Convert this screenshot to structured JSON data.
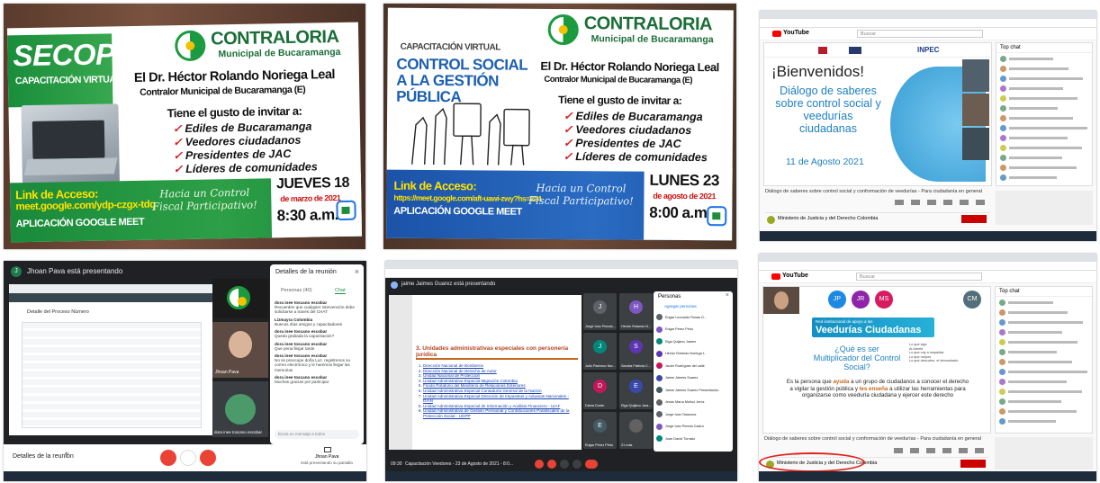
{
  "tile1": {
    "title": "SECOP II",
    "subtitle": "CAPACITACIÓN VIRTUAL",
    "org_line1": "CONTRALORIA",
    "org_line2": "Municipal de Bucaramanga",
    "presenter": "El Dr. Héctor Rolando Noriega Leal",
    "role": "Contralor Municipal de Bucaramanga (E)",
    "invite": "Tiene el gusto de invitar a:",
    "bullets": [
      "Ediles de Bucaramanga",
      "Veedores ciudadanos",
      "Presidentes de JAC",
      "Líderes de comunidades"
    ],
    "link_label": "Link de Acceso:",
    "link": "meet.google.com/ydp-czgx-tdq",
    "app": "APLICACIÓN GOOGLE MEET",
    "slogan": "Hacia un Control Fiscal Participativo!",
    "day": "JUEVES 18",
    "month": "de marzo de 2021",
    "time": "8:30 a.m.",
    "meet_caption": "Google Meet"
  },
  "tile2": {
    "subtitle": "CAPACITACIÓN VIRTUAL",
    "title": "CONTROL SOCIAL A LA GESTIÓN PÚBLICA",
    "org_line1": "CONTRALORIA",
    "org_line2": "Municipal de Bucaramanga",
    "presenter": "El Dr. Héctor Rolando Noriega Leal",
    "role": "Contralor Municipal de Bucaramanga (E)",
    "invite": "Tiene el gusto de invitar a:",
    "bullets": [
      "Ediles de Bucaramanga",
      "Veedores ciudadanos",
      "Presidentes de JAC",
      "Líderes de comunidades"
    ],
    "link_label": "Link de Acceso:",
    "link": "https://meet.google.com/aft-uawi-zwy?hs=224",
    "app": "APLICACIÓN GOOGLE MEET",
    "slogan": "Hacia un Control Fiscal Participativo!",
    "day": "LUNES 23",
    "month": "de agosto de 2021",
    "time": "8:00 a.m."
  },
  "tile3": {
    "yt_label": "YouTube",
    "search_placeholder": "Buscar",
    "welcome": "¡Bienvenidos!",
    "heading": "Diálogo de saberes sobre control social y veedurías ciudadanas",
    "date": "11 de Agosto 2021",
    "inpec": "INPEC",
    "video_title": "Diálogo de saberes sobre control social y conformación de veedurías - Para ciudadanía en general",
    "channel": "Ministerio de Justicia y del Derecho Colombia",
    "chat_header": "Top chat",
    "accent": "#2ea3dc"
  },
  "tile4": {
    "presenting": "Jhoan Pava está presentando",
    "panel_title": "Detalles de la reunión",
    "people_tab": "Personas (40)",
    "chat_tab": "Chat",
    "messages": [
      {
        "author": "dora inee toscano escobar",
        "text": "Recuerden que cualquier intervención debe solicitarse a través del CHAT"
      },
      {
        "author": "Lizmayra Colombia",
        "text": "Buenos días amigos y capacitadores"
      },
      {
        "author": "dora inee toscano escobar",
        "text": "Queda grabada la capacitación?"
      },
      {
        "author": "dora inee toscano escobar",
        "text": "Que pena llegar tarde"
      },
      {
        "author": "dora inee toscano escobar",
        "text": "No se preocupe doña Luz, registrenos su correo electrónico y le haremos llegar las memorias"
      },
      {
        "author": "dora inee toscano escobar",
        "text": "Muchas gracias por participar"
      }
    ],
    "composer": "Envía un mensaje a todos",
    "details_bottom": "Detalles de la reunión",
    "presenter_name": "Jhoan Pava",
    "presenter_status": "está presentando su pantalla",
    "person1": "Jhoan Pava",
    "person2": "dora inee toscano escobar",
    "page_title": "Detalle del Proceso Número"
  },
  "tile5": {
    "presenting": "jaime Jaimes Guarez está presentando",
    "panel_title": "Personas",
    "add_people": "Agregar personas",
    "people": [
      "Edgar Leonardo Rosas D...",
      "Edgar Pérez Pinto",
      "Elga Quijano Juarez",
      "Héctor Rolando Noriega L.",
      "Javier Rodríguez del valle",
      "Jaime Jaimes Suarez",
      "Jaime Jaimes Suarez Presentación",
      "Jesús María Muñoz Jerez",
      "Jorge Ivan Tarazona",
      "Jorge Ivan Pineda Castro",
      "Juan David Tórrado"
    ],
    "slide_heading": "3. Unidades administrativas especiales con personería jurídica",
    "slide_items": [
      "Dirección Nacional de Bomberos",
      "Dirección Nacional de Derecho de Autor",
      "Unidad Nacional de Protección",
      "Unidad Administrativa Especial Migración Colombia",
      "Fondo Rotatorio del Ministerio de Relaciones Exteriores",
      "Unidad Administrativa Especial Contaduría General de la Nación",
      "Unidad Administrativa Especial Dirección de Impuestos y Aduanas Nacionales - DIAN",
      "Unidad Administrativa Especial de Información y Análisis Financiero - UIAF",
      "Unidad Administrativa de Gestión Pensional y Contribuciones Parafiscales de la Protección Social - UGPP"
    ],
    "tiles": [
      {
        "initial": "J",
        "name": "Jorge Ivan Pineda..."
      },
      {
        "initial": "H",
        "name": "Héctor Rolando N..."
      },
      {
        "initial": "J",
        "name": "Julio Pacheco Nor..."
      },
      {
        "initial": "S",
        "name": "Sandra Patricia C..."
      },
      {
        "initial": "D",
        "name": "Diana Durán"
      },
      {
        "initial": "E",
        "name": "Elga Quijano Jara..."
      },
      {
        "initial": "E",
        "name": "Edgar Pérez Pinto"
      },
      {
        "initial": "",
        "name": "21 más"
      }
    ],
    "footer_time": "09:30",
    "footer_title": "Capacitación Veedores - 23 de Agosto de 2021 - 8:0..."
  },
  "tile6": {
    "participants": [
      "JP",
      "JR",
      "MS",
      "CM"
    ],
    "slide_title_small": "Red institucional de apoyo a las",
    "slide_title": "Veedurías Ciudadanas",
    "question": "¿Qué es ser Multiplicador del Control Social?",
    "body_pre": "Es la persona que ",
    "body_bold1": "ayuda",
    "body_mid1": " a un grupo de ciudadanos a conocer el derecho a vigilar la gestión pública y ",
    "body_bold2": "les enseña",
    "body_post": " a utilizar las herramientas para organizarse como veeduría ciudadana y ejercer este derecho",
    "side_notes": [
      "Lo que sigo",
      "Al cliente",
      "Lo que voy a respaldar",
      "Lo que mejoro",
      "Lo que descubro, el demostrado"
    ],
    "video_title": "Diálogo de saberes sobre control social y conformación de veedurías - Para ciudadanía en general",
    "channel": "Ministerio de Justicia y del Derecho Colombia",
    "chat_header": "Top chat",
    "yt_label": "YouTube",
    "search_placeholder": "Buscar"
  }
}
